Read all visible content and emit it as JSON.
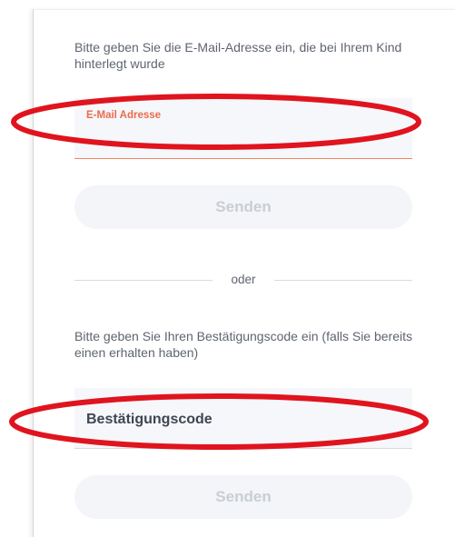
{
  "email_section": {
    "instruction": "Bitte geben Sie die E-Mail-Adresse ein, die bei Ihrem Kind hinterlegt wurde",
    "field_label": "E-Mail Adresse",
    "field_value": "",
    "send_button": "Senden"
  },
  "divider": {
    "label": "oder"
  },
  "code_section": {
    "instruction": "Bitte geben Sie Ihren Bestätigungscode ein (falls Sie bereits einen erhalten haben)",
    "field_label": "Bestätigungscode",
    "field_value": "",
    "send_button": "Senden"
  },
  "colors": {
    "accent": "#ea6c4c",
    "annotation": "#e0141e",
    "button_bg": "#f3f5f8",
    "button_text": "#c9ced5",
    "field_bg": "#f5f7fa"
  }
}
